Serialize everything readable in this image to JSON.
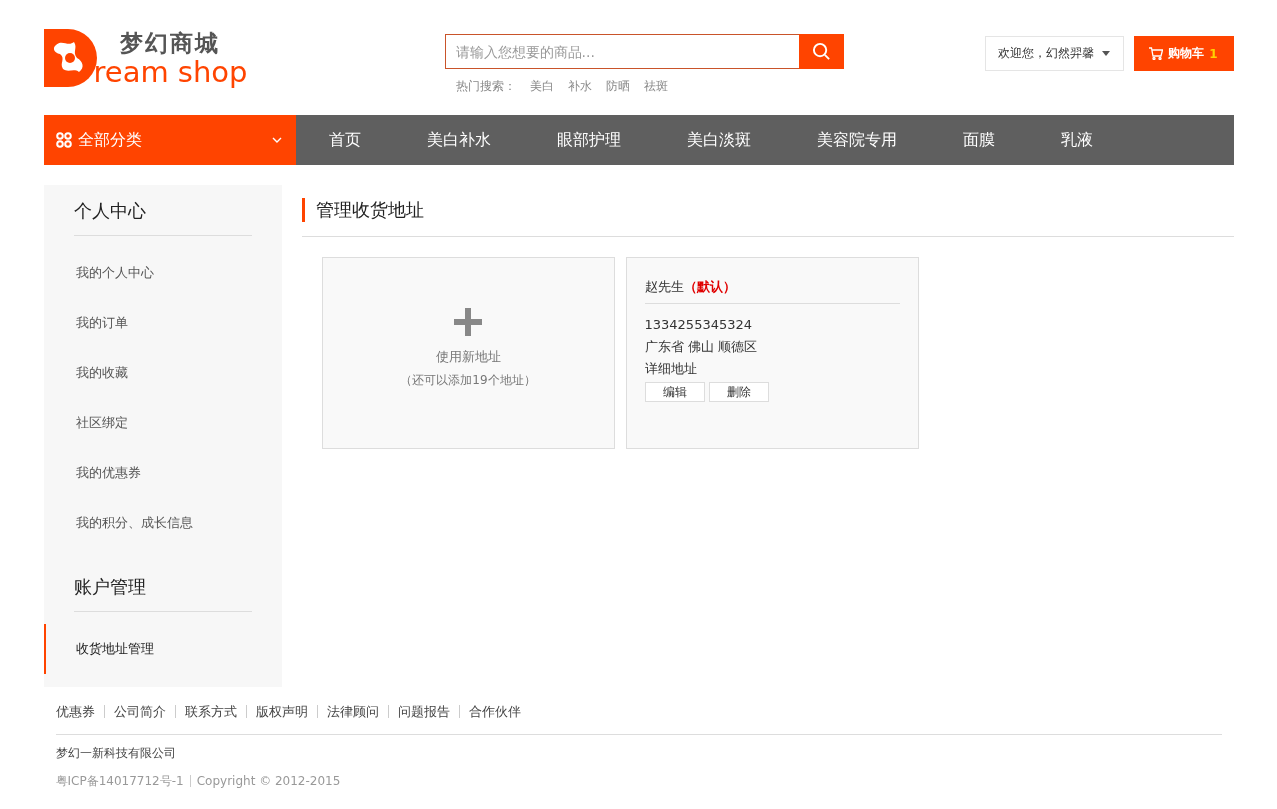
{
  "logo": {
    "title": "梦幻商城",
    "subtitle": "ream shop"
  },
  "search": {
    "placeholder": "请输入您想要的商品...",
    "hot_label": "热门搜索：",
    "hot_terms": [
      "美白",
      "补水",
      "防晒",
      "祛斑"
    ]
  },
  "user_menu": {
    "label": "欢迎您，幻然羿馨"
  },
  "cart": {
    "label": "购物车",
    "count": "1"
  },
  "nav": {
    "category_button": "全部分类",
    "items": [
      "首页",
      "美白补水",
      "眼部护理",
      "美白淡斑",
      "美容院专用",
      "面膜",
      "乳液"
    ]
  },
  "sidebar": {
    "sections": [
      {
        "title": "个人中心",
        "items": [
          {
            "label": "我的个人中心",
            "selected": false
          },
          {
            "label": "我的订单",
            "selected": false
          },
          {
            "label": "我的收藏",
            "selected": false
          },
          {
            "label": "社区绑定",
            "selected": false
          },
          {
            "label": "我的优惠券",
            "selected": false
          },
          {
            "label": "我的积分、成长信息",
            "selected": false
          }
        ]
      },
      {
        "title": "账户管理",
        "items": [
          {
            "label": "收货地址管理",
            "selected": true
          }
        ]
      }
    ]
  },
  "content": {
    "title": "管理收货地址",
    "new_address": {
      "label": "使用新地址",
      "note": "（还可以添加19个地址）"
    },
    "addresses": [
      {
        "name": "赵先生",
        "default_tag": "（默认）",
        "phone": "1334255345324",
        "region": "广东省 佛山 顺德区",
        "detail": "详细地址",
        "actions": [
          "编辑",
          "删除"
        ]
      }
    ]
  },
  "footer": {
    "links": [
      "优惠券",
      "公司简介",
      "联系方式",
      "版权声明",
      "法律顾问",
      "问题报告",
      "合作伙伴"
    ],
    "company": "梦幻一新科技有限公司",
    "icp": "粤ICP备14017712号-1",
    "copyright": "Copyright © 2012-2015"
  }
}
